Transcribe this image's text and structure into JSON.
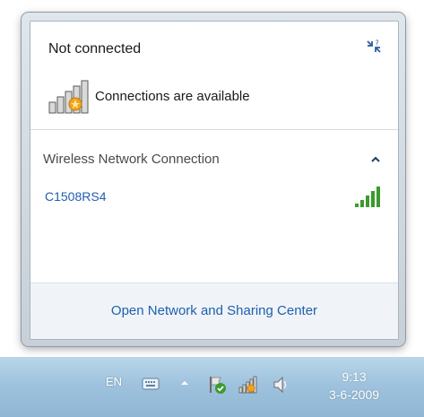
{
  "flyout": {
    "status_title": "Not connected",
    "available_text": "Connections are available",
    "section_header": "Wireless Network Connection",
    "networks": [
      {
        "name": "C1508RS4"
      }
    ],
    "footer_link": "Open Network and Sharing Center"
  },
  "taskbar": {
    "language": "EN",
    "time": "9:13",
    "date": "3-6-2009"
  },
  "icons": {
    "help": "network-troubleshoot-icon",
    "availability": "signal-bars-with-star-icon",
    "collapse": "chevron-up-icon",
    "signal": "signal-strength-icon",
    "keyboard": "keyboard-icon",
    "show_hidden": "up-arrow-icon",
    "action_center": "flag-check-icon",
    "network_tray": "network-tray-icon",
    "volume": "speaker-icon"
  },
  "colors": {
    "link": "#1f5fae",
    "signal_green": "#3c9a2e",
    "star_orange": "#f2a51a",
    "taskbar": "#9fc3de"
  }
}
